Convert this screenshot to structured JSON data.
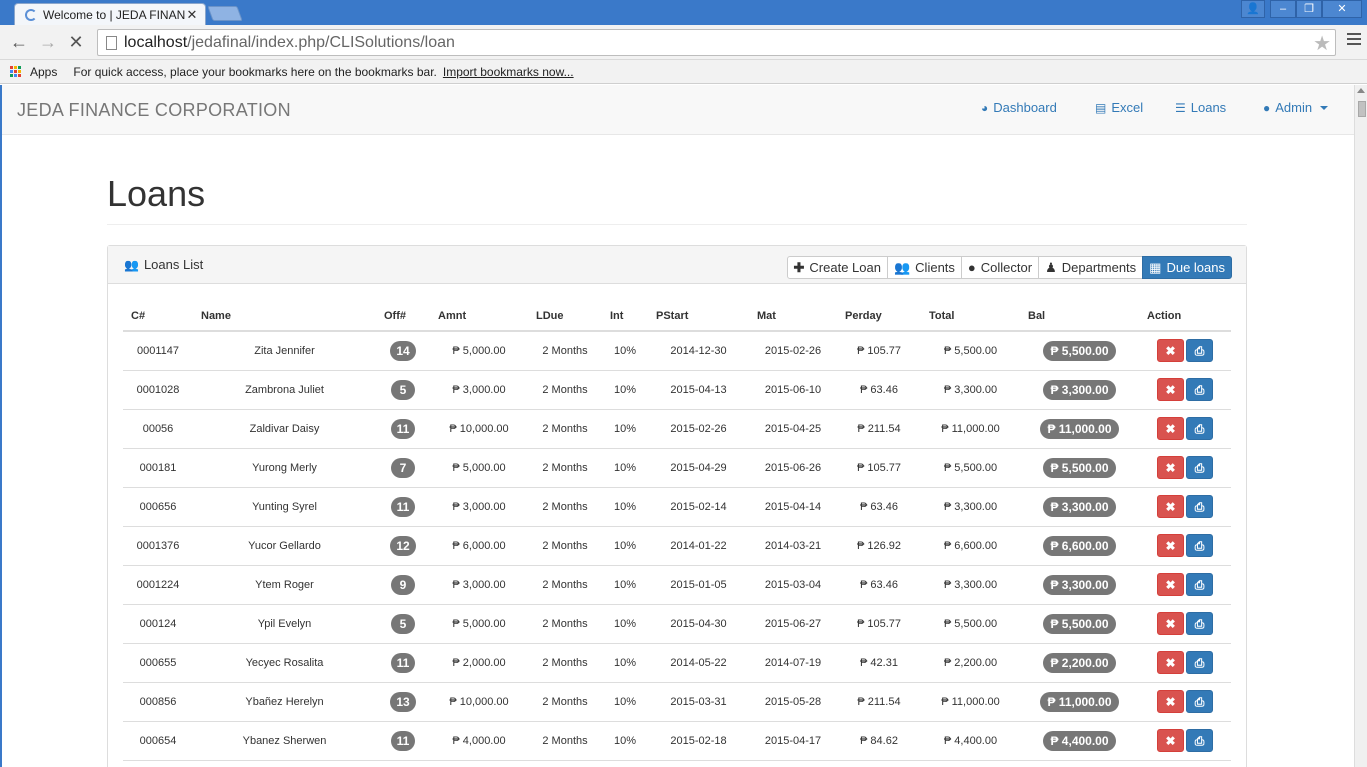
{
  "browser": {
    "tab_title": "Welcome to | JEDA FINANCE",
    "url_host": "localhost",
    "url_path": "/jedafinal/index.php/CLISolutions/loan",
    "bookmarks": {
      "apps_label": "Apps",
      "hint": "For quick access, place your bookmarks here on the bookmarks bar.",
      "import_link": "Import bookmarks now..."
    }
  },
  "navbar": {
    "brand": "JEDA FINANCE CORPORATION",
    "links": {
      "dashboard": "Dashboard",
      "excel": "Excel",
      "loans": "Loans",
      "admin": "Admin"
    }
  },
  "page": {
    "title": "Loans"
  },
  "panel": {
    "title": "Loans List",
    "buttons": {
      "create_loan": "Create Loan",
      "clients": "Clients",
      "collector": "Collector",
      "departments": "Departments",
      "due_loans": "Due loans"
    }
  },
  "table": {
    "headers": [
      "C#",
      "Name",
      "Off#",
      "Amnt",
      "LDue",
      "Int",
      "PStart",
      "Mat",
      "Perday",
      "Total",
      "Bal",
      "Action"
    ],
    "rows": [
      {
        "c": "0001147",
        "name": "Zita Jennifer",
        "off": "14",
        "amnt": "₱ 5,000.00",
        "ldue": "2 Months",
        "int": "10%",
        "pstart": "2014-12-30",
        "mat": "2015-02-26",
        "perday": "₱ 105.77",
        "total": "₱ 5,500.00",
        "bal": "₱ 5,500.00"
      },
      {
        "c": "0001028",
        "name": "Zambrona Juliet",
        "off": "5",
        "amnt": "₱ 3,000.00",
        "ldue": "2 Months",
        "int": "10%",
        "pstart": "2015-04-13",
        "mat": "2015-06-10",
        "perday": "₱ 63.46",
        "total": "₱ 3,300.00",
        "bal": "₱ 3,300.00"
      },
      {
        "c": "00056",
        "name": "Zaldivar Daisy",
        "off": "11",
        "amnt": "₱ 10,000.00",
        "ldue": "2 Months",
        "int": "10%",
        "pstart": "2015-02-26",
        "mat": "2015-04-25",
        "perday": "₱ 211.54",
        "total": "₱ 11,000.00",
        "bal": "₱ 11,000.00"
      },
      {
        "c": "000181",
        "name": "Yurong Merly",
        "off": "7",
        "amnt": "₱ 5,000.00",
        "ldue": "2 Months",
        "int": "10%",
        "pstart": "2015-04-29",
        "mat": "2015-06-26",
        "perday": "₱ 105.77",
        "total": "₱ 5,500.00",
        "bal": "₱ 5,500.00"
      },
      {
        "c": "000656",
        "name": "Yunting Syrel",
        "off": "11",
        "amnt": "₱ 3,000.00",
        "ldue": "2 Months",
        "int": "10%",
        "pstart": "2015-02-14",
        "mat": "2015-04-14",
        "perday": "₱ 63.46",
        "total": "₱ 3,300.00",
        "bal": "₱ 3,300.00"
      },
      {
        "c": "0001376",
        "name": "Yucor Gellardo",
        "off": "12",
        "amnt": "₱ 6,000.00",
        "ldue": "2 Months",
        "int": "10%",
        "pstart": "2014-01-22",
        "mat": "2014-03-21",
        "perday": "₱ 126.92",
        "total": "₱ 6,600.00",
        "bal": "₱ 6,600.00"
      },
      {
        "c": "0001224",
        "name": "Ytem Roger",
        "off": "9",
        "amnt": "₱ 3,000.00",
        "ldue": "2 Months",
        "int": "10%",
        "pstart": "2015-01-05",
        "mat": "2015-03-04",
        "perday": "₱ 63.46",
        "total": "₱ 3,300.00",
        "bal": "₱ 3,300.00"
      },
      {
        "c": "000124",
        "name": "Ypil Evelyn",
        "off": "5",
        "amnt": "₱ 5,000.00",
        "ldue": "2 Months",
        "int": "10%",
        "pstart": "2015-04-30",
        "mat": "2015-06-27",
        "perday": "₱ 105.77",
        "total": "₱ 5,500.00",
        "bal": "₱ 5,500.00"
      },
      {
        "c": "000655",
        "name": "Yecyec Rosalita",
        "off": "11",
        "amnt": "₱ 2,000.00",
        "ldue": "2 Months",
        "int": "10%",
        "pstart": "2014-05-22",
        "mat": "2014-07-19",
        "perday": "₱ 42.31",
        "total": "₱ 2,200.00",
        "bal": "₱ 2,200.00"
      },
      {
        "c": "000856",
        "name": "Ybañez Herelyn",
        "off": "13",
        "amnt": "₱ 10,000.00",
        "ldue": "2 Months",
        "int": "10%",
        "pstart": "2015-03-31",
        "mat": "2015-05-28",
        "perday": "₱ 211.54",
        "total": "₱ 11,000.00",
        "bal": "₱ 11,000.00"
      },
      {
        "c": "000654",
        "name": "Ybanez Sherwen",
        "off": "11",
        "amnt": "₱ 4,000.00",
        "ldue": "2 Months",
        "int": "10%",
        "pstart": "2015-02-18",
        "mat": "2015-04-17",
        "perday": "₱ 84.62",
        "total": "₱ 4,400.00",
        "bal": "₱ 4,400.00"
      }
    ]
  },
  "colors": {
    "link": "#337ab7",
    "danger": "#d9534f",
    "badge": "#777777",
    "chrome": "#3a79c9"
  },
  "icons": {
    "dashboard": "tachometer-icon",
    "excel": "file-excel-icon",
    "loans": "list-icon",
    "admin": "user-icon",
    "panel": "users-icon",
    "create": "plus-icon",
    "delete": "times-icon",
    "print": "print-icon"
  }
}
